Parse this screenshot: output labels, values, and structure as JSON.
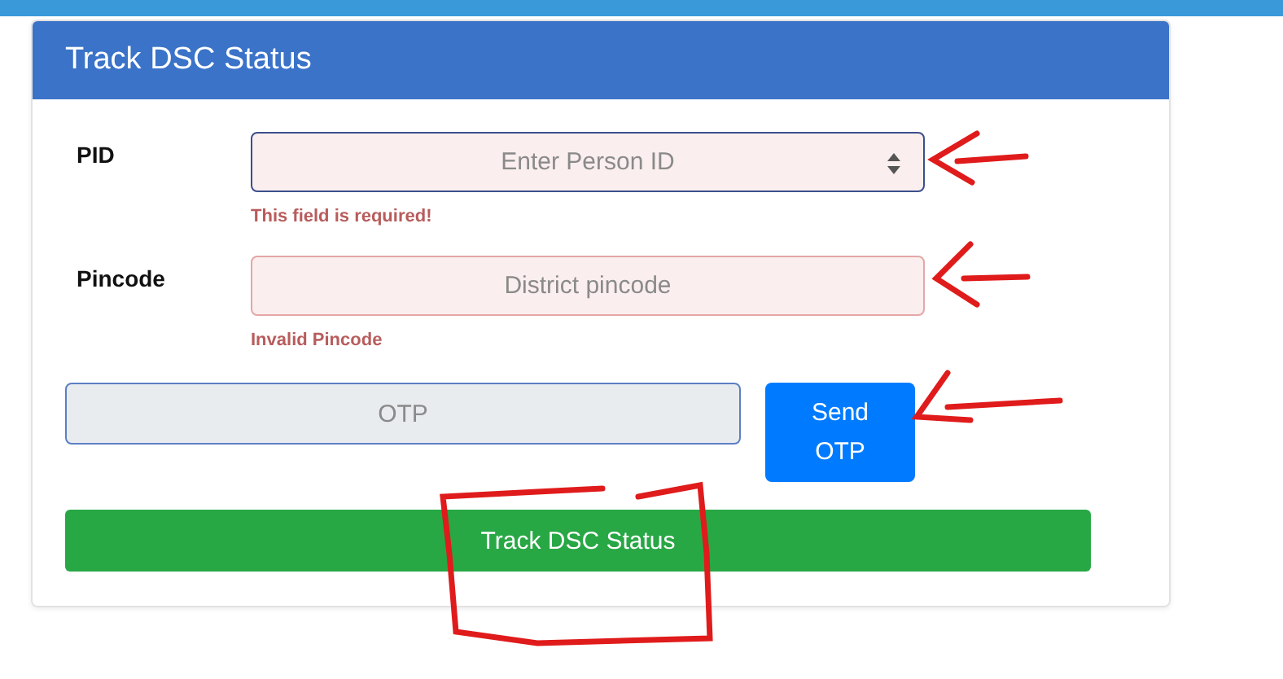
{
  "card": {
    "title": "Track DSC Status"
  },
  "fields": [
    {
      "label": "PID",
      "placeholder": "Enter Person ID",
      "kind": "number",
      "invalid": true,
      "focused": true,
      "error": "This field is required!"
    },
    {
      "label": "Pincode",
      "placeholder": "District pincode",
      "kind": "text",
      "invalid": true,
      "focused": false,
      "error": "Invalid Pincode"
    }
  ],
  "otp": {
    "placeholder": "OTP",
    "disabled": true,
    "button": "Send OTP"
  },
  "submit": "Track DSC Status"
}
